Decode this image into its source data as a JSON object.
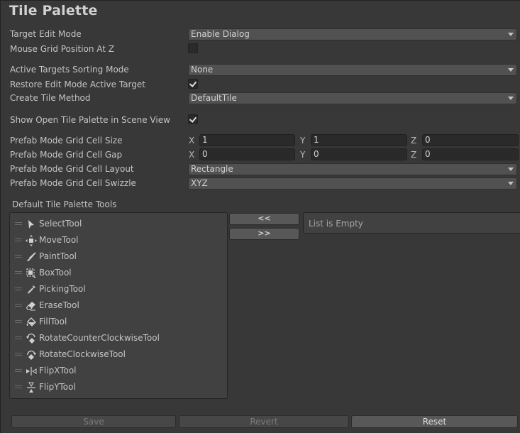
{
  "title": "Tile Palette",
  "settings": {
    "target_edit_mode": {
      "label": "Target Edit Mode",
      "value": "Enable Dialog"
    },
    "mouse_grid_position": {
      "label": "Mouse Grid Position At Z",
      "checked": false
    },
    "active_targets_sorting": {
      "label": "Active Targets Sorting Mode",
      "value": "None"
    },
    "restore_edit_mode": {
      "label": "Restore Edit Mode Active Target",
      "checked": true
    },
    "create_tile_method": {
      "label": "Create Tile Method",
      "value": "DefaultTile"
    },
    "show_open_tile_palette": {
      "label": "Show Open Tile Palette in Scene View",
      "checked": true
    },
    "cell_size": {
      "label": "Prefab Mode Grid Cell Size",
      "x_label": "X",
      "y_label": "Y",
      "z_label": "Z",
      "x": "1",
      "y": "1",
      "z": "0"
    },
    "cell_gap": {
      "label": "Prefab Mode Grid Cell Gap",
      "x_label": "X",
      "y_label": "Y",
      "z_label": "Z",
      "x": "0",
      "y": "0",
      "z": "0"
    },
    "cell_layout": {
      "label": "Prefab Mode Grid Cell Layout",
      "value": "Rectangle"
    },
    "cell_swizzle": {
      "label": "Prefab Mode Grid Cell Swizzle",
      "value": "XYZ"
    }
  },
  "tools": {
    "section_label": "Default Tile Palette Tools",
    "items": [
      {
        "name": "SelectTool",
        "icon": "select-arrow-icon"
      },
      {
        "name": "MoveTool",
        "icon": "move-icon"
      },
      {
        "name": "PaintTool",
        "icon": "paint-brush-icon"
      },
      {
        "name": "BoxTool",
        "icon": "box-select-icon"
      },
      {
        "name": "PickingTool",
        "icon": "eyedropper-icon"
      },
      {
        "name": "EraseTool",
        "icon": "eraser-icon"
      },
      {
        "name": "FillTool",
        "icon": "paint-bucket-icon"
      },
      {
        "name": "RotateCounterClockwiseTool",
        "icon": "rotate-ccw-icon"
      },
      {
        "name": "RotateClockwiseTool",
        "icon": "rotate-cw-icon"
      },
      {
        "name": "FlipXTool",
        "icon": "flip-x-icon"
      },
      {
        "name": "FlipYTool",
        "icon": "flip-y-icon"
      }
    ],
    "move_left_label": "<<",
    "move_right_label": ">>",
    "empty_list_text": "List is Empty"
  },
  "footer": {
    "save_label": "Save",
    "revert_label": "Revert",
    "reset_label": "Reset"
  }
}
